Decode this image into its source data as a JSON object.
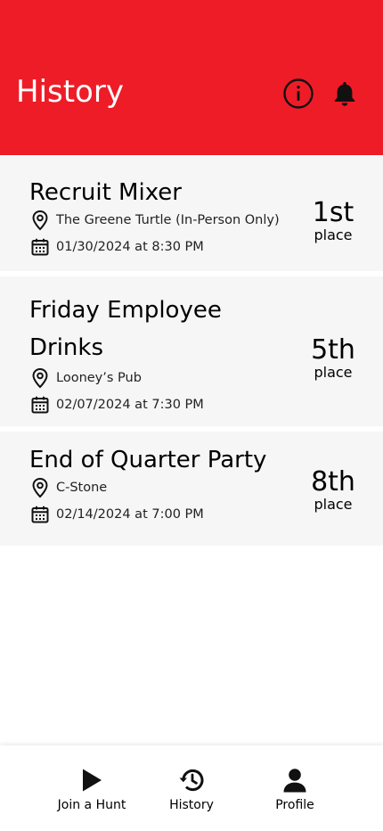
{
  "header": {
    "title": "History",
    "background_color": "#ee1c27",
    "info_icon": "info-circle-icon",
    "notification_icon": "bell-icon"
  },
  "events": [
    {
      "title": "Recruit Mixer",
      "location": "The Greene Turtle (In-Person Only)",
      "datetime": "01/30/2024 at 8:30 PM",
      "place": "1st",
      "place_label": "place"
    },
    {
      "title": "Friday Employee Drinks",
      "location": "Looney’s Pub",
      "datetime": "02/07/2024 at 7:30 PM",
      "place": "5th",
      "place_label": "place"
    },
    {
      "title": "End of Quarter Party",
      "location": "C-Stone",
      "datetime": "02/14/2024 at 7:00 PM",
      "place": "8th",
      "place_label": "place"
    }
  ],
  "tabbar": {
    "items": [
      {
        "label": "Join a Hunt",
        "icon": "play-icon"
      },
      {
        "label": "History",
        "icon": "history-icon"
      },
      {
        "label": "Profile",
        "icon": "user-icon"
      }
    ]
  }
}
